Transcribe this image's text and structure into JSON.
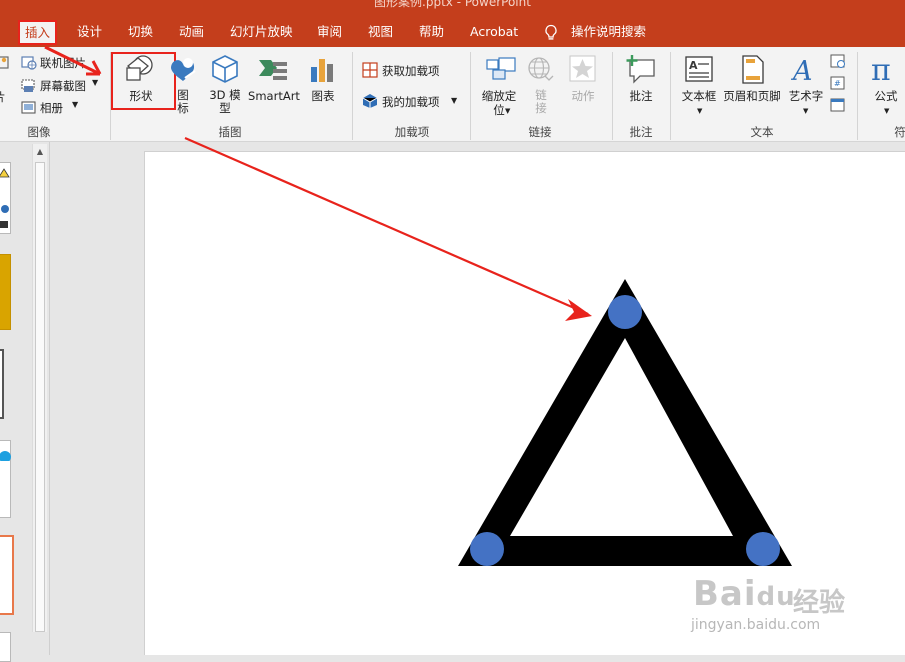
{
  "window": {
    "document_title": "图形案例.pptx - PowerPoint"
  },
  "tabs": [
    {
      "label": "插入",
      "active": true
    },
    {
      "label": "设计"
    },
    {
      "label": "切换"
    },
    {
      "label": "动画"
    },
    {
      "label": "幻灯片放映"
    },
    {
      "label": "审阅"
    },
    {
      "label": "视图"
    },
    {
      "label": "帮助"
    },
    {
      "label": "Acrobat"
    },
    {
      "label": "操作说明搜索",
      "icon": "lightbulb-icon"
    }
  ],
  "ribbon": {
    "images_group": {
      "label": "图像",
      "items": [
        {
          "label": "联机图片",
          "icon": "online-picture-icon"
        },
        {
          "label": "屏幕截图",
          "icon": "screenshot-icon"
        },
        {
          "label": "相册",
          "icon": "photo-album-icon"
        }
      ],
      "partial_label": "片"
    },
    "illustrations_group": {
      "label": "插图",
      "buttons": [
        {
          "label": "形状",
          "icon": "shapes-icon",
          "highlighted": true
        },
        {
          "label": "图标",
          "icon": "icons-icon"
        },
        {
          "label": "3D 模型",
          "icon": "3d-model-icon"
        },
        {
          "label": "SmartArt",
          "icon": "smartart-icon"
        },
        {
          "label": "图表",
          "icon": "chart-icon"
        }
      ]
    },
    "addins_group": {
      "label": "加载项",
      "items": [
        {
          "label": "获取加载项",
          "icon": "store-icon"
        },
        {
          "label": "我的加载项",
          "icon": "my-addins-icon"
        }
      ]
    },
    "links_group": {
      "label": "链接",
      "buttons": [
        {
          "label": "缩放定位",
          "icon": "zoom-icon"
        },
        {
          "label": "链接",
          "icon": "link-icon",
          "disabled": true
        },
        {
          "label": "动作",
          "icon": "action-icon",
          "disabled": true
        }
      ]
    },
    "comments_group": {
      "label": "批注",
      "buttons": [
        {
          "label": "批注",
          "icon": "comment-icon"
        }
      ]
    },
    "text_group": {
      "label": "文本",
      "buttons": [
        {
          "label": "文本框",
          "icon": "textbox-icon"
        },
        {
          "label": "页眉和页脚",
          "icon": "header-footer-icon"
        },
        {
          "label": "艺术字",
          "icon": "wordart-icon"
        }
      ]
    },
    "symbols_group": {
      "label": "符",
      "buttons": [
        {
          "label": "公式",
          "icon": "equation-icon"
        }
      ]
    }
  },
  "slide": {
    "triangle": {
      "color": "#000000",
      "handle_color": "#4472c4"
    }
  },
  "watermark": {
    "main": "Bai",
    "paw": "du",
    "cn": "经验",
    "url": "jingyan.baidu.com"
  },
  "colors": {
    "accent": "#c43e1c",
    "annotation_red": "#e8231c",
    "handle_blue": "#4472c4"
  }
}
